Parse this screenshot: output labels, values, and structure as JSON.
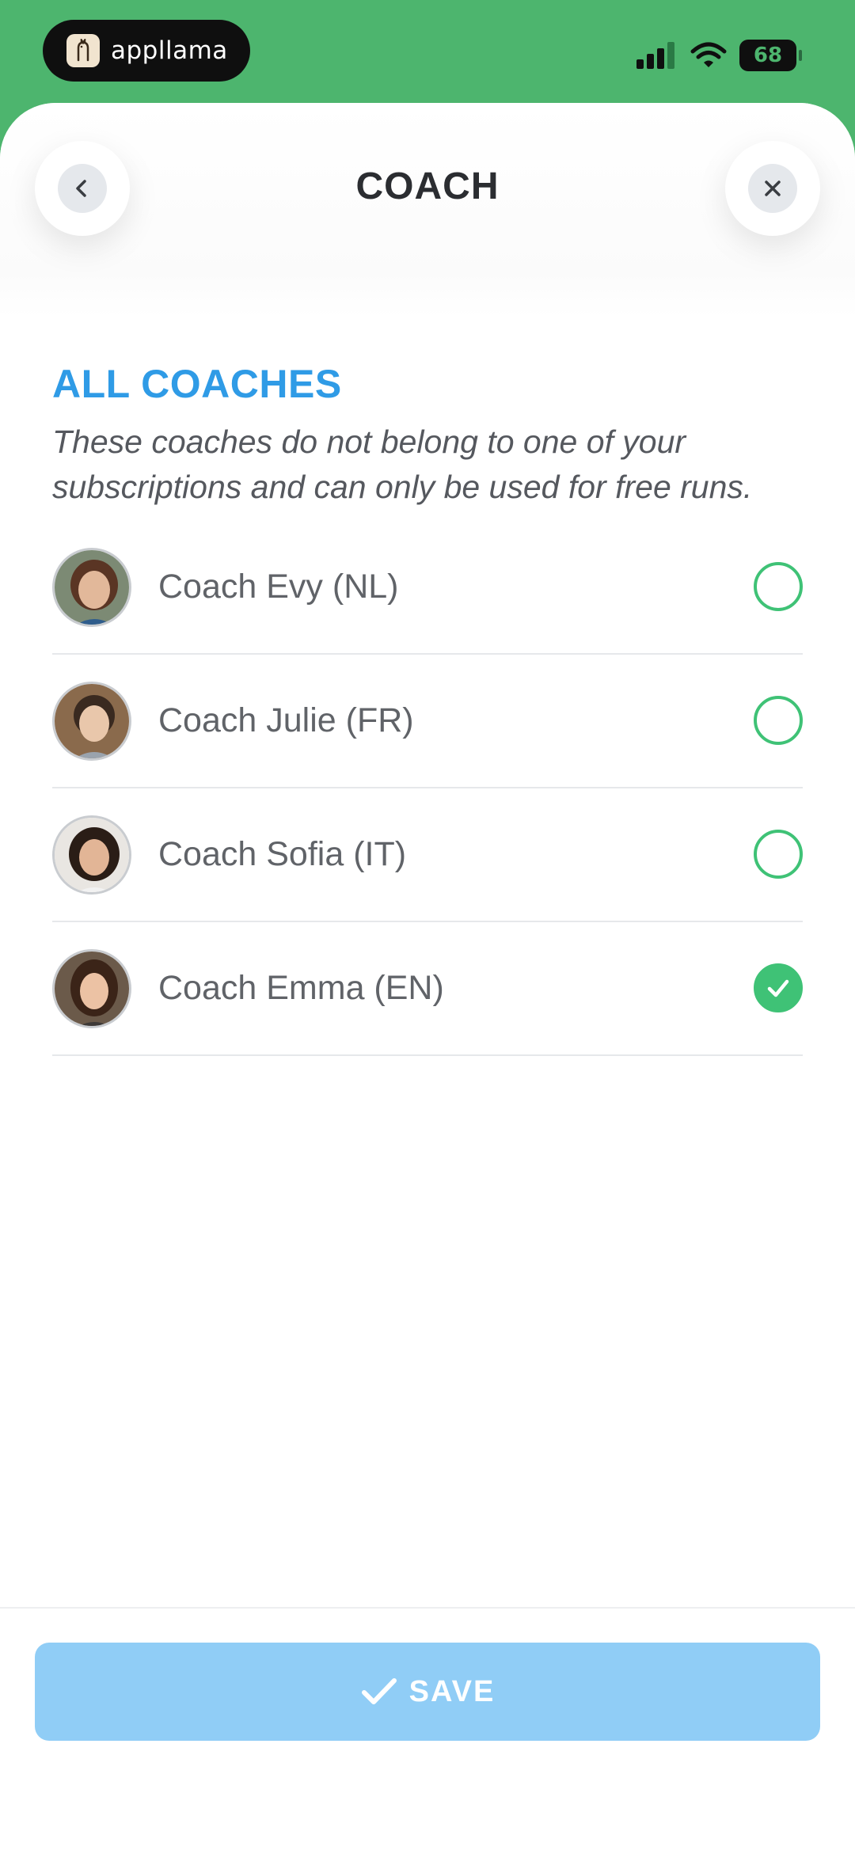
{
  "status_bar": {
    "app_pill_label": "appllama",
    "battery_level": "68"
  },
  "header": {
    "title": "COACH",
    "back_icon": "chevron-left-icon",
    "close_icon": "close-icon"
  },
  "section": {
    "title": "ALL COACHES",
    "description": "These coaches do not belong to one of your subscriptions and can only be used for free runs."
  },
  "coaches": [
    {
      "name": "Coach Evy (NL)",
      "selected": false
    },
    {
      "name": "Coach Julie (FR)",
      "selected": false
    },
    {
      "name": "Coach Sofia (IT)",
      "selected": false
    },
    {
      "name": "Coach Emma (EN)",
      "selected": true
    }
  ],
  "footer": {
    "save_label": "SAVE"
  },
  "colors": {
    "brand_green": "#4db56e",
    "accent_blue": "#2f9be6",
    "selected_green": "#3fc276",
    "save_button": "#90cdf6"
  }
}
